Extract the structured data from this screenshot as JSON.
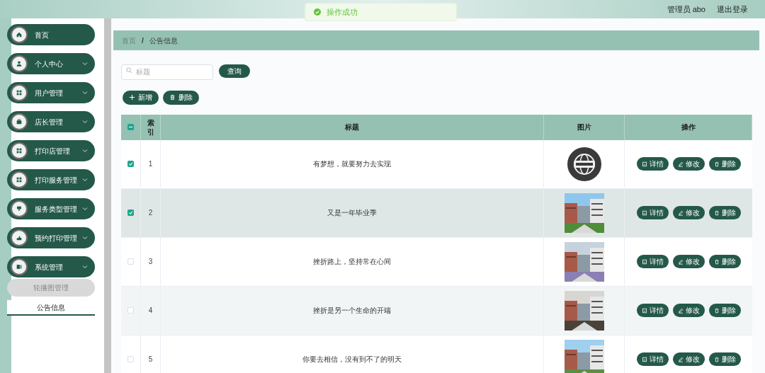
{
  "header": {
    "user": "管理员 abo",
    "logout": "退出登录"
  },
  "toast": {
    "text": "操作成功"
  },
  "sidebar": {
    "items": [
      {
        "label": "首页",
        "expandable": false
      },
      {
        "label": "个人中心",
        "expandable": true
      },
      {
        "label": "用户管理",
        "expandable": true
      },
      {
        "label": "店长管理",
        "expandable": true
      },
      {
        "label": "打印店管理",
        "expandable": true
      },
      {
        "label": "打印服务管理",
        "expandable": true
      },
      {
        "label": "服务类型管理",
        "expandable": true
      },
      {
        "label": "预约打印管理",
        "expandable": true
      },
      {
        "label": "系统管理",
        "expandable": true,
        "children": [
          {
            "label": "轮播图管理",
            "selected": false
          },
          {
            "label": "公告信息",
            "selected": true
          }
        ]
      }
    ]
  },
  "breadcrumb": {
    "items": [
      "首页",
      "公告信息"
    ],
    "separator": "/"
  },
  "search": {
    "placeholder": "标题",
    "button": "查询"
  },
  "actions": [
    "新增",
    "删除"
  ],
  "table": {
    "header_indeterminate": true,
    "columns": [
      "索引",
      "标题",
      "图片",
      "操作"
    ],
    "rows": [
      {
        "checked": true,
        "selected": false,
        "index": "1",
        "title": "有梦想，就要努力去实现",
        "image": {
          "kind": "picture"
        },
        "buttons": [
          "详情",
          "修改",
          "删除"
        ]
      },
      {
        "checked": true,
        "selected": true,
        "index": "2",
        "title": "又是一年毕业季",
        "image": {
          "kind": "picture"
        },
        "buttons": [
          "详情",
          "修改",
          "删除"
        ]
      },
      {
        "checked": false,
        "selected": false,
        "index": "3",
        "title": "挫折路上，坚持常在心间",
        "image": {
          "kind": "picture"
        },
        "buttons": [
          "详情",
          "修改",
          "删除"
        ]
      },
      {
        "checked": false,
        "selected": false,
        "index": "4",
        "title": "挫折是另一个生命的开端",
        "image": {
          "kind": "picture"
        },
        "buttons": [
          "详情",
          "修改",
          "删除"
        ]
      },
      {
        "checked": false,
        "selected": false,
        "index": "5",
        "title": "你要去相信，没有到不了的明天",
        "image": {
          "kind": "picture"
        },
        "buttons": [
          "详情",
          "修改",
          "删除"
        ]
      }
    ]
  }
}
